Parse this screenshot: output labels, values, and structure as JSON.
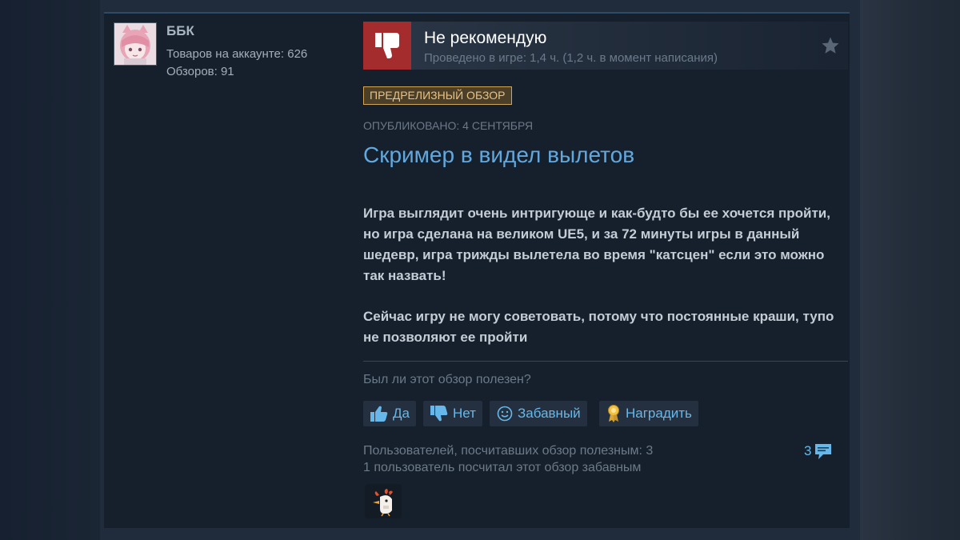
{
  "author": {
    "name": "ББК",
    "products": "Товаров на аккаунте: 626",
    "reviews": "Обзоров: 91"
  },
  "review": {
    "verdict": "Не рекомендую",
    "hours": "Проведено в игре: 1,4 ч. (1,2 ч. в момент написания)",
    "badge": "ПРЕДРЕЛИЗНЫЙ ОБЗОР",
    "posted": "ОПУБЛИКОВАНО: 4 СЕНТЯБРЯ",
    "title": "Скример в видел вылетов",
    "paragraphs": [
      "Игра выглядит очень интригующе и как-будто бы ее хочется пройти, но игра сделана на великом UE5, и за 72 минуты игры в данный шедевр, игра трижды вылетела во время \"катсцен\" если это можно так назвать!",
      "Сейчас игру не могу советовать, потому что постоянные краши, тупо не позволяют ее пройти"
    ]
  },
  "feedback": {
    "question": "Был ли этот обзор полезен?",
    "buttons": {
      "yes": "Да",
      "no": "Нет",
      "funny": "Забавный",
      "award": "Наградить"
    },
    "helpful_stat": "Пользователей, посчитавших обзор полезным: 3",
    "funny_stat": "1 пользователь посчитал этот обзор забавным",
    "comments_count": "3"
  },
  "colors": {
    "link_blue": "#67b8ea",
    "title_blue": "#62a8dd",
    "thumb_red": "#a52c2c",
    "badge_gold": "#d1a65b"
  },
  "icons": {
    "verdict": "thumbs-down-icon",
    "favorite": "star-icon",
    "yes": "thumbs-up-icon",
    "no": "thumbs-down-icon",
    "funny": "smiley-icon",
    "award": "award-icon",
    "comments": "speech-bubble-icon",
    "award_given": "chicken-award-icon"
  }
}
